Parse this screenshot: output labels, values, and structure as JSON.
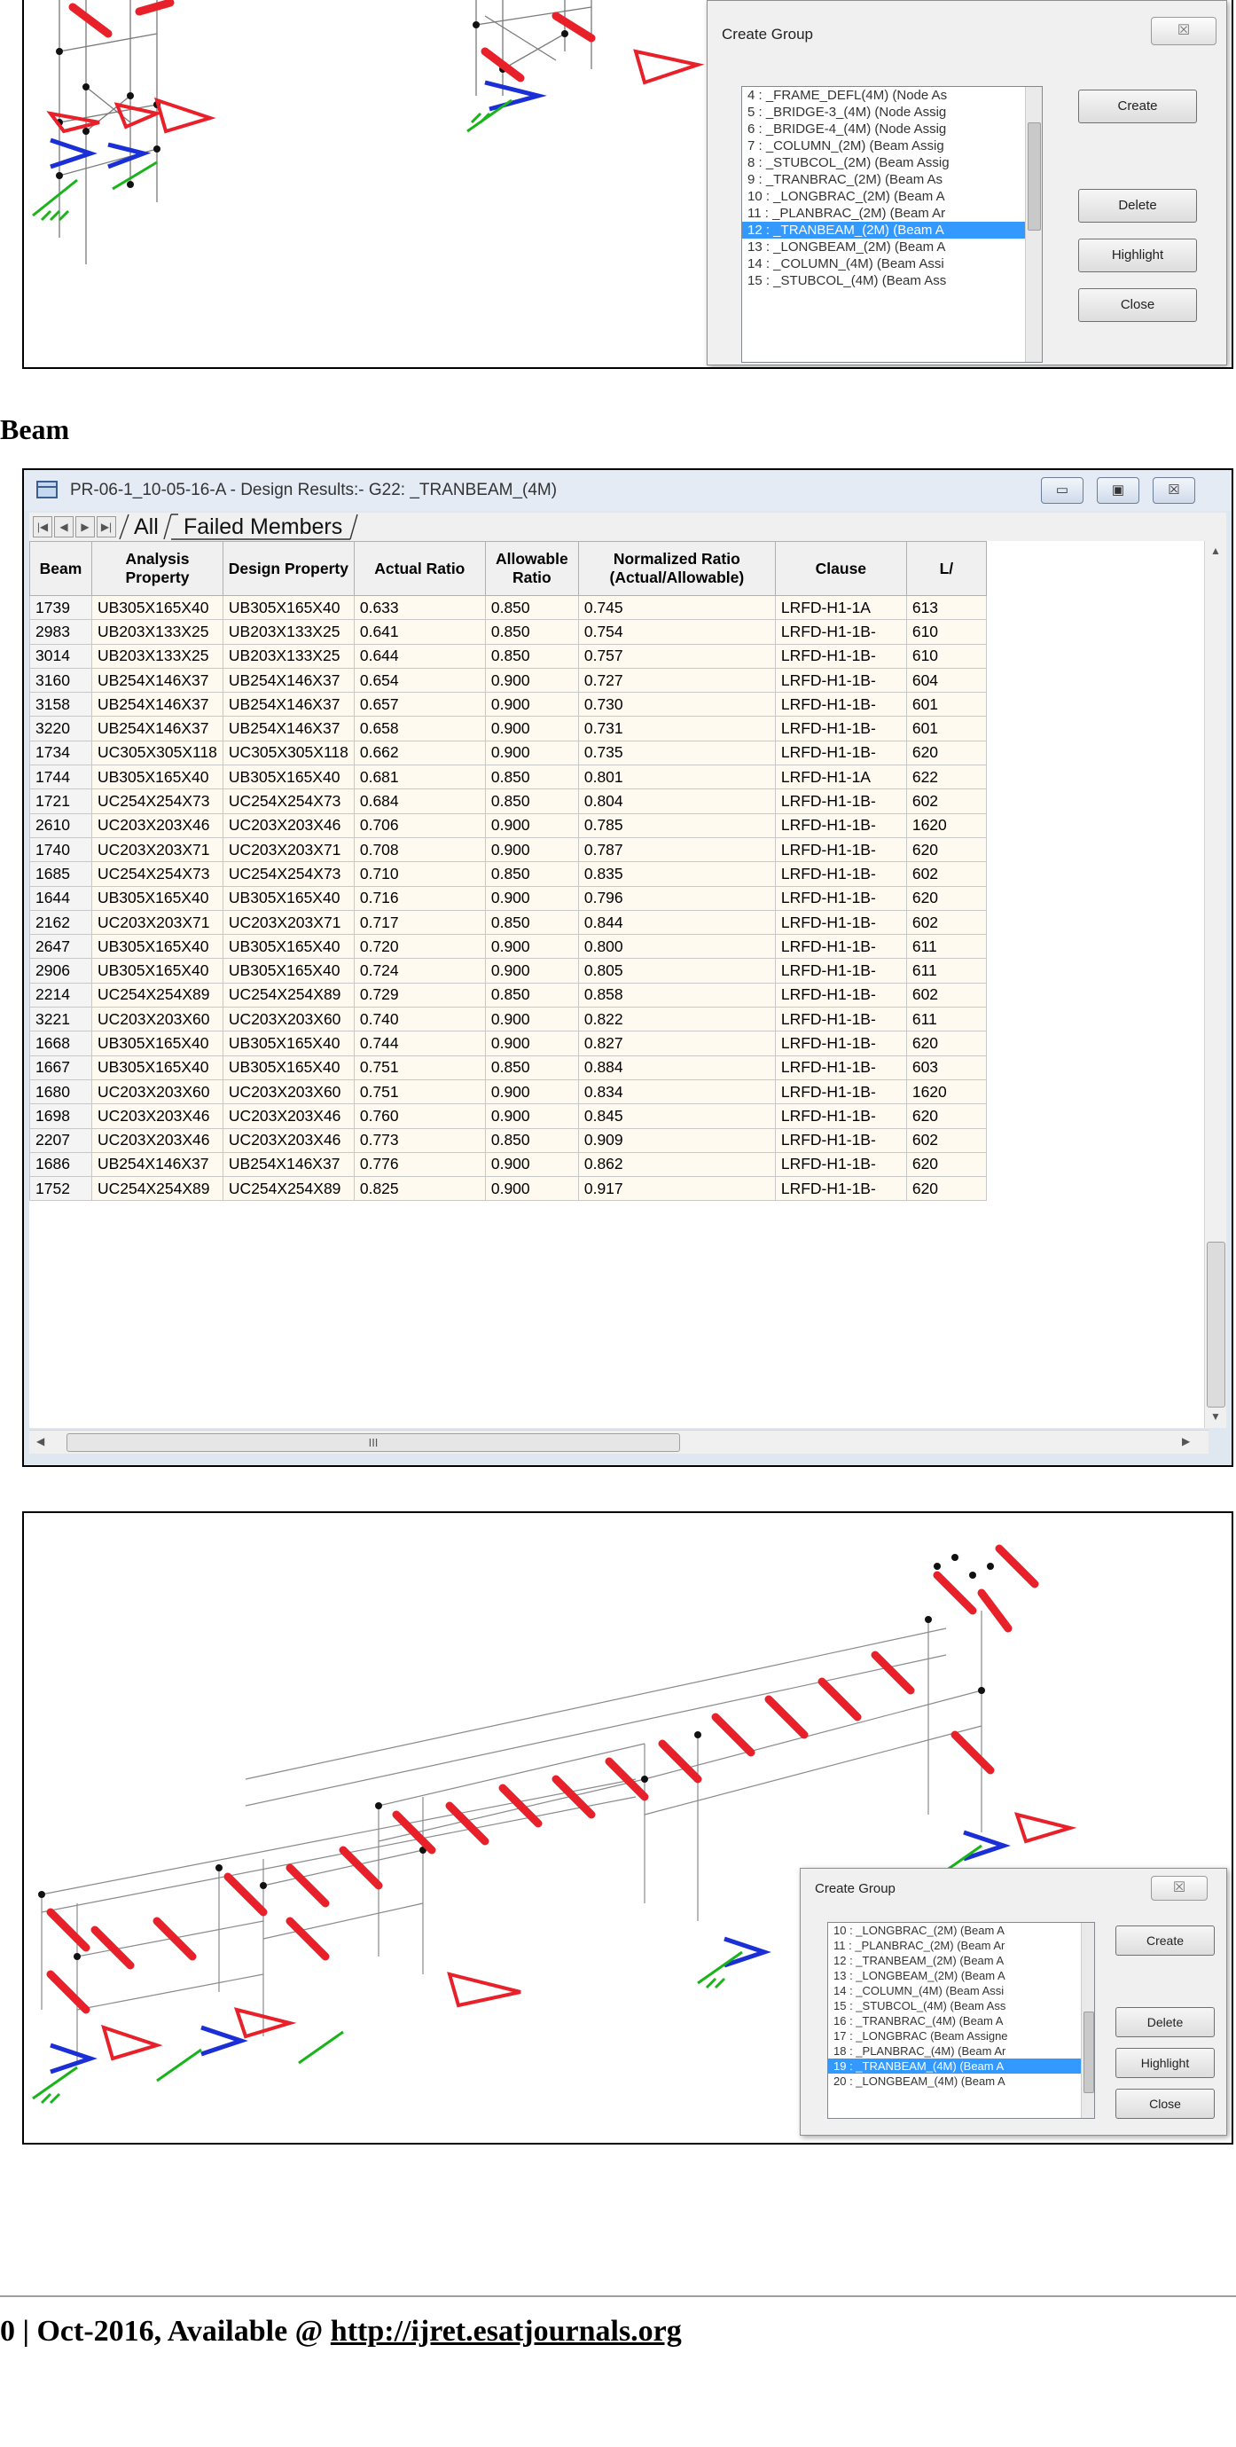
{
  "section_heading": "Beam",
  "top_dialog": {
    "title": "Create Group",
    "close_glyph": "☒",
    "list": [
      "4 : _FRAME_DEFL(4M) (Node As",
      "5 : _BRIDGE-3_(4M) (Node Assig",
      "6 : _BRIDGE-4_(4M) (Node Assig",
      "7 : _COLUMN_(2M) (Beam Assig",
      "8 : _STUBCOL_(2M) (Beam Assig",
      "9 : _TRANBRAC_(2M) (Beam As",
      "10 : _LONGBRAC_(2M) (Beam A",
      "11 : _PLANBRAC_(2M) (Beam Ar",
      "12 : _TRANBEAM_(2M) (Beam A",
      "13 : _LONGBEAM_(2M) (Beam A",
      "14 : _COLUMN_(4M) (Beam Assi",
      "15 : _STUBCOL_(4M) (Beam Ass"
    ],
    "selected_index": 8,
    "buttons": [
      "Create",
      "Delete",
      "Highlight",
      "Close"
    ]
  },
  "bottom_dialog": {
    "title": "Create Group",
    "close_glyph": "☒",
    "list": [
      "10 : _LONGBRAC_(2M) (Beam A",
      "11 : _PLANBRAC_(2M) (Beam Ar",
      "12 : _TRANBEAM_(2M) (Beam A",
      "13 : _LONGBEAM_(2M) (Beam A",
      "14 : _COLUMN_(4M) (Beam Assi",
      "15 : _STUBCOL_(4M) (Beam Ass",
      "16 : _TRANBRAC_(4M) (Beam A",
      "17 : _LONGBRAC (Beam Assigne",
      "18 : _PLANBRAC_(4M) (Beam Ar",
      "19 : _TRANBEAM_(4M) (Beam A",
      "20 : _LONGBEAM_(4M) (Beam A"
    ],
    "selected_index": 9,
    "buttons": [
      "Create",
      "Delete",
      "Highlight",
      "Close"
    ]
  },
  "results_window": {
    "title": "PR-06-1_10-05-16-A - Design Results:- G22: _TRANBEAM_(4M)",
    "controls": [
      "▭",
      "▣",
      "☒"
    ],
    "nav_arrows": [
      "|◀",
      "◀",
      "▶",
      "▶|"
    ],
    "tabs": [
      "All",
      "Failed Members"
    ],
    "columns": [
      "Beam",
      "Analysis Property",
      "Design Property",
      "Actual Ratio",
      "Allowable Ratio",
      "Normalized Ratio (Actual/Allowable)",
      "Clause",
      "L/"
    ],
    "rows": [
      [
        "1739",
        "UB305X165X40",
        "UB305X165X40",
        "0.633",
        "0.850",
        "0.745",
        "LRFD-H1-1A",
        "613"
      ],
      [
        "2983",
        "UB203X133X25",
        "UB203X133X25",
        "0.641",
        "0.850",
        "0.754",
        "LRFD-H1-1B-",
        "610"
      ],
      [
        "3014",
        "UB203X133X25",
        "UB203X133X25",
        "0.644",
        "0.850",
        "0.757",
        "LRFD-H1-1B-",
        "610"
      ],
      [
        "3160",
        "UB254X146X37",
        "UB254X146X37",
        "0.654",
        "0.900",
        "0.727",
        "LRFD-H1-1B-",
        "604"
      ],
      [
        "3158",
        "UB254X146X37",
        "UB254X146X37",
        "0.657",
        "0.900",
        "0.730",
        "LRFD-H1-1B-",
        "601"
      ],
      [
        "3220",
        "UB254X146X37",
        "UB254X146X37",
        "0.658",
        "0.900",
        "0.731",
        "LRFD-H1-1B-",
        "601"
      ],
      [
        "1734",
        "UC305X305X118",
        "UC305X305X118",
        "0.662",
        "0.900",
        "0.735",
        "LRFD-H1-1B-",
        "620"
      ],
      [
        "1744",
        "UB305X165X40",
        "UB305X165X40",
        "0.681",
        "0.850",
        "0.801",
        "LRFD-H1-1A",
        "622"
      ],
      [
        "1721",
        "UC254X254X73",
        "UC254X254X73",
        "0.684",
        "0.850",
        "0.804",
        "LRFD-H1-1B-",
        "602"
      ],
      [
        "2610",
        "UC203X203X46",
        "UC203X203X46",
        "0.706",
        "0.900",
        "0.785",
        "LRFD-H1-1B-",
        "1620"
      ],
      [
        "1740",
        "UC203X203X71",
        "UC203X203X71",
        "0.708",
        "0.900",
        "0.787",
        "LRFD-H1-1B-",
        "620"
      ],
      [
        "1685",
        "UC254X254X73",
        "UC254X254X73",
        "0.710",
        "0.850",
        "0.835",
        "LRFD-H1-1B-",
        "602"
      ],
      [
        "1644",
        "UB305X165X40",
        "UB305X165X40",
        "0.716",
        "0.900",
        "0.796",
        "LRFD-H1-1B-",
        "620"
      ],
      [
        "2162",
        "UC203X203X71",
        "UC203X203X71",
        "0.717",
        "0.850",
        "0.844",
        "LRFD-H1-1B-",
        "602"
      ],
      [
        "2647",
        "UB305X165X40",
        "UB305X165X40",
        "0.720",
        "0.900",
        "0.800",
        "LRFD-H1-1B-",
        "611"
      ],
      [
        "2906",
        "UB305X165X40",
        "UB305X165X40",
        "0.724",
        "0.900",
        "0.805",
        "LRFD-H1-1B-",
        "611"
      ],
      [
        "2214",
        "UC254X254X89",
        "UC254X254X89",
        "0.729",
        "0.850",
        "0.858",
        "LRFD-H1-1B-",
        "602"
      ],
      [
        "3221",
        "UC203X203X60",
        "UC203X203X60",
        "0.740",
        "0.900",
        "0.822",
        "LRFD-H1-1B-",
        "611"
      ],
      [
        "1668",
        "UB305X165X40",
        "UB305X165X40",
        "0.744",
        "0.900",
        "0.827",
        "LRFD-H1-1B-",
        "620"
      ],
      [
        "1667",
        "UB305X165X40",
        "UB305X165X40",
        "0.751",
        "0.850",
        "0.884",
        "LRFD-H1-1B-",
        "603"
      ],
      [
        "1680",
        "UC203X203X60",
        "UC203X203X60",
        "0.751",
        "0.900",
        "0.834",
        "LRFD-H1-1B-",
        "1620"
      ],
      [
        "1698",
        "UC203X203X46",
        "UC203X203X46",
        "0.760",
        "0.900",
        "0.845",
        "LRFD-H1-1B-",
        "620"
      ],
      [
        "2207",
        "UC203X203X46",
        "UC203X203X46",
        "0.773",
        "0.850",
        "0.909",
        "LRFD-H1-1B-",
        "602"
      ],
      [
        "1686",
        "UB254X146X37",
        "UB254X146X37",
        "0.776",
        "0.900",
        "0.862",
        "LRFD-H1-1B-",
        "620"
      ],
      [
        "1752",
        "UC254X254X89",
        "UC254X254X89",
        "0.825",
        "0.900",
        "0.917",
        "LRFD-H1-1B-",
        "620"
      ]
    ],
    "hscroll_grip": "III"
  },
  "colors": {
    "member_highlight": "#e8202a",
    "support_blue": "#1a2fd6",
    "support_green": "#19b419",
    "selection": "#3399ff"
  },
  "footer": {
    "text": "0 | Oct-2016, Available @ ",
    "link": "http://ijret.esatjournals.org"
  }
}
